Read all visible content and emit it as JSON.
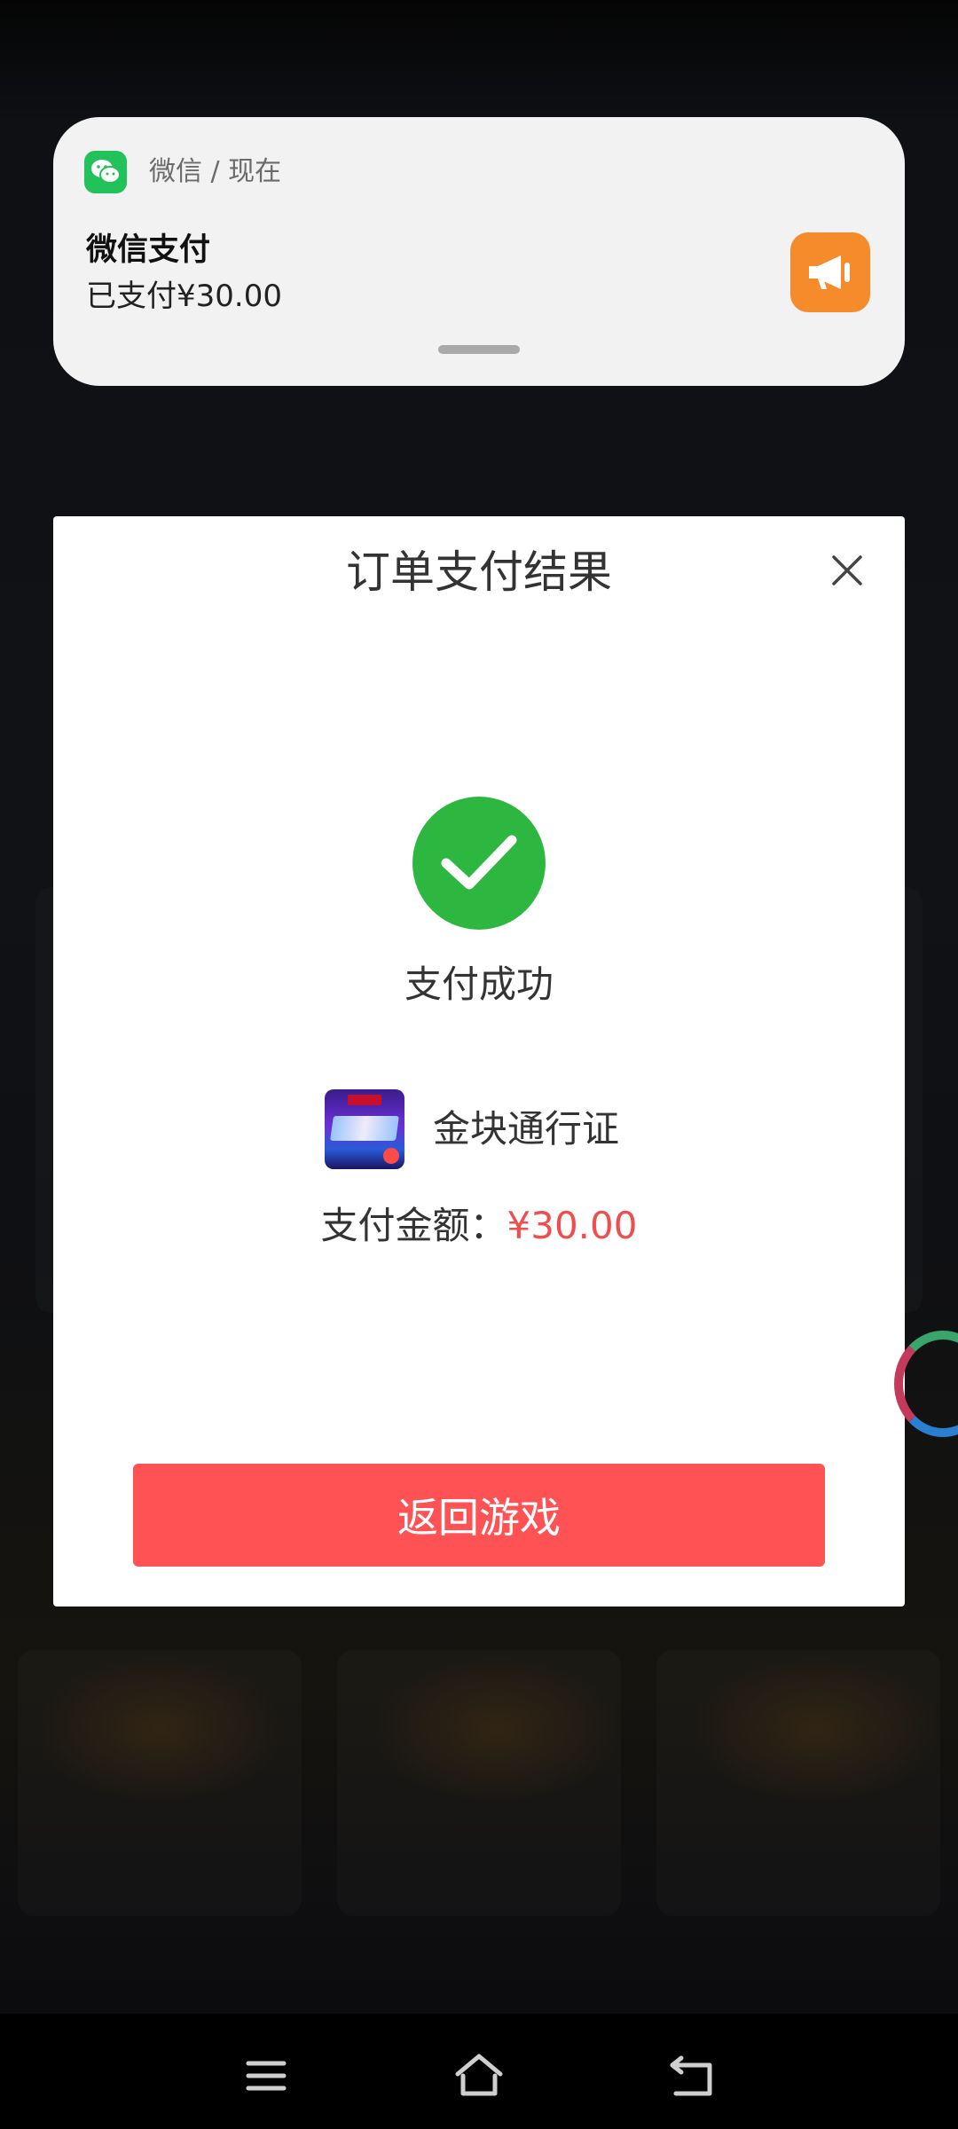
{
  "notification": {
    "app_name": "微信 / 现在",
    "title": "微信支付",
    "body": "已支付¥30.00",
    "app_icon": "wechat-icon",
    "action_icon": "megaphone-icon",
    "accent_color": "#f58b2b"
  },
  "dialog": {
    "title": "订单支付结果",
    "close_icon": "close-icon",
    "status_icon": "checkmark-icon",
    "status_text": "支付成功",
    "product_icon": "marvel-game-icon",
    "product_name": "金块通行证",
    "amount_label": "支付金额：",
    "amount_value": "¥30.00",
    "return_button": "返回游戏",
    "success_color": "#2db741",
    "button_color": "#ff5254",
    "amount_color": "#ee4e4e"
  },
  "nav": {
    "menu_icon": "menu-icon",
    "home_icon": "home-icon",
    "back_icon": "back-icon"
  }
}
